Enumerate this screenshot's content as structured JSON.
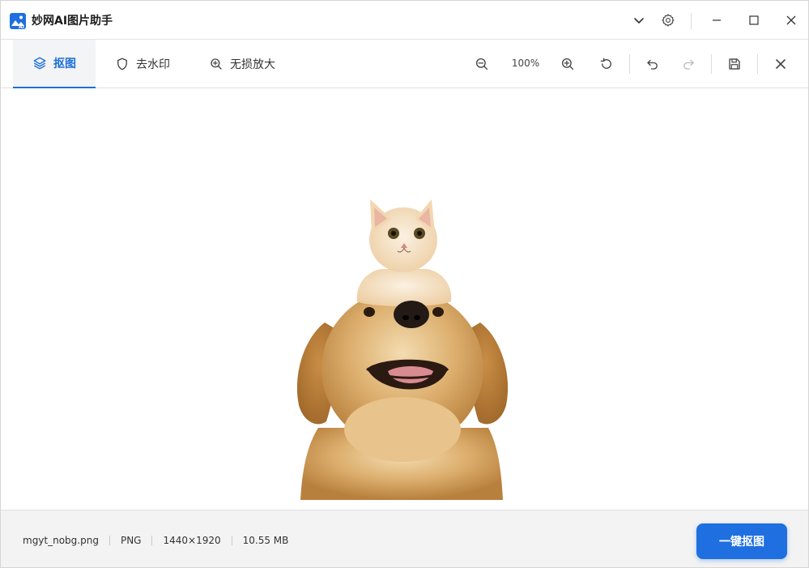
{
  "app": {
    "title": "妙网AI图片助手",
    "logo_icon": "photo-ai-logo"
  },
  "titlebar": {
    "icons": [
      "chevron-down-icon",
      "gear-icon",
      "minimize-icon",
      "maximize-icon",
      "close-icon"
    ]
  },
  "tabs": [
    {
      "label": "抠图",
      "icon": "layers-icon",
      "active": true
    },
    {
      "label": "去水印",
      "icon": "shield-icon",
      "active": false
    },
    {
      "label": "无损放大",
      "icon": "zoom-plus-icon",
      "active": false
    }
  ],
  "toolbar": {
    "zoom_level": "100%",
    "icons": [
      "zoom-out-icon",
      "zoom-in-icon",
      "reset-rotate-icon",
      "undo-icon",
      "redo-icon",
      "save-icon",
      "close-icon"
    ]
  },
  "image": {
    "subject": "cat sitting on golden retriever's head, background removed"
  },
  "footer": {
    "filename": "mgyt_nobg.png",
    "format": "PNG",
    "dimensions": "1440×1920",
    "size": "10.55 MB",
    "action_label": "一键抠图"
  },
  "colors": {
    "accent": "#1f6fe0",
    "tab_active_bg": "#f3f4f6",
    "footer_bg": "#f3f3f3"
  }
}
